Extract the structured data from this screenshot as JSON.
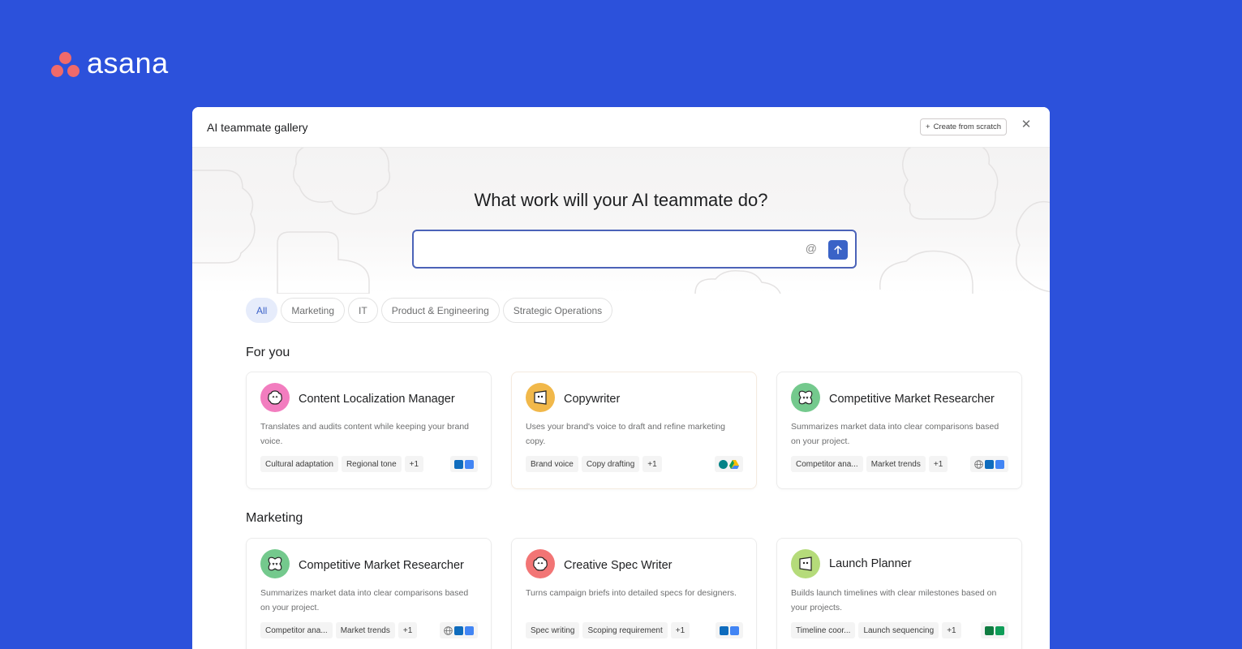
{
  "brand": {
    "name": "asana"
  },
  "window": {
    "title": "AI teammate gallery",
    "create_label": "Create from scratch",
    "close_glyph": "✕"
  },
  "hero": {
    "title": "What work will your AI teammate do?"
  },
  "prompt": {
    "value": "",
    "at_glyph": "@"
  },
  "filters": [
    "All",
    "Marketing",
    "IT",
    "Product & Engineering",
    "Strategic Operations"
  ],
  "sections": {
    "for_you": {
      "title": "For you",
      "cards": [
        {
          "title": "Content Localization Manager",
          "desc": "Translates and audits content while keeping your brand voice.",
          "tags": [
            "Cultural adaptation",
            "Regional tone",
            "+1"
          ],
          "avatar_color": "#f27dbf",
          "apps": [
            "outlook-icon",
            "docs-icon"
          ]
        },
        {
          "title": "Copywriter",
          "desc": "Uses your brand's voice to draft and refine marketing copy.",
          "tags": [
            "Brand voice",
            "Copy drafting",
            "+1"
          ],
          "avatar_color": "#f1b84a",
          "apps": [
            "sharepoint-icon",
            "drive-icon"
          ]
        },
        {
          "title": "Competitive Market Researcher",
          "desc": "Summarizes market data into clear comparisons based on your project.",
          "tags": [
            "Competitor ana...",
            "Market trends",
            "+1"
          ],
          "avatar_color": "#74c98d",
          "apps": [
            "globe-icon",
            "outlook-icon",
            "docs-icon"
          ]
        }
      ]
    },
    "marketing": {
      "title": "Marketing",
      "cards": [
        {
          "title": "Competitive Market Researcher",
          "desc": "Summarizes market data into clear comparisons based on your project.",
          "tags": [
            "Competitor ana...",
            "Market trends",
            "+1"
          ],
          "avatar_color": "#74c98d",
          "apps": [
            "globe-icon",
            "outlook-icon",
            "docs-icon"
          ]
        },
        {
          "title": "Creative Spec Writer",
          "desc": "Turns campaign briefs into detailed specs for designers.",
          "tags": [
            "Spec writing",
            "Scoping requirement",
            "+1"
          ],
          "avatar_color": "#f27575",
          "apps": [
            "outlook-icon",
            "docs-icon"
          ]
        },
        {
          "title": "Launch Planner",
          "desc": "Builds launch timelines with clear milestones based on your projects.",
          "tags": [
            "Timeline coor...",
            "Launch sequencing",
            "+1"
          ],
          "avatar_color": "#b5db7a",
          "apps": [
            "excel-icon",
            "sheets-icon"
          ]
        }
      ]
    }
  },
  "colors": {
    "background": "#2c51db",
    "accent": "#3a63c7",
    "brand_coral": "#f06a6a"
  }
}
